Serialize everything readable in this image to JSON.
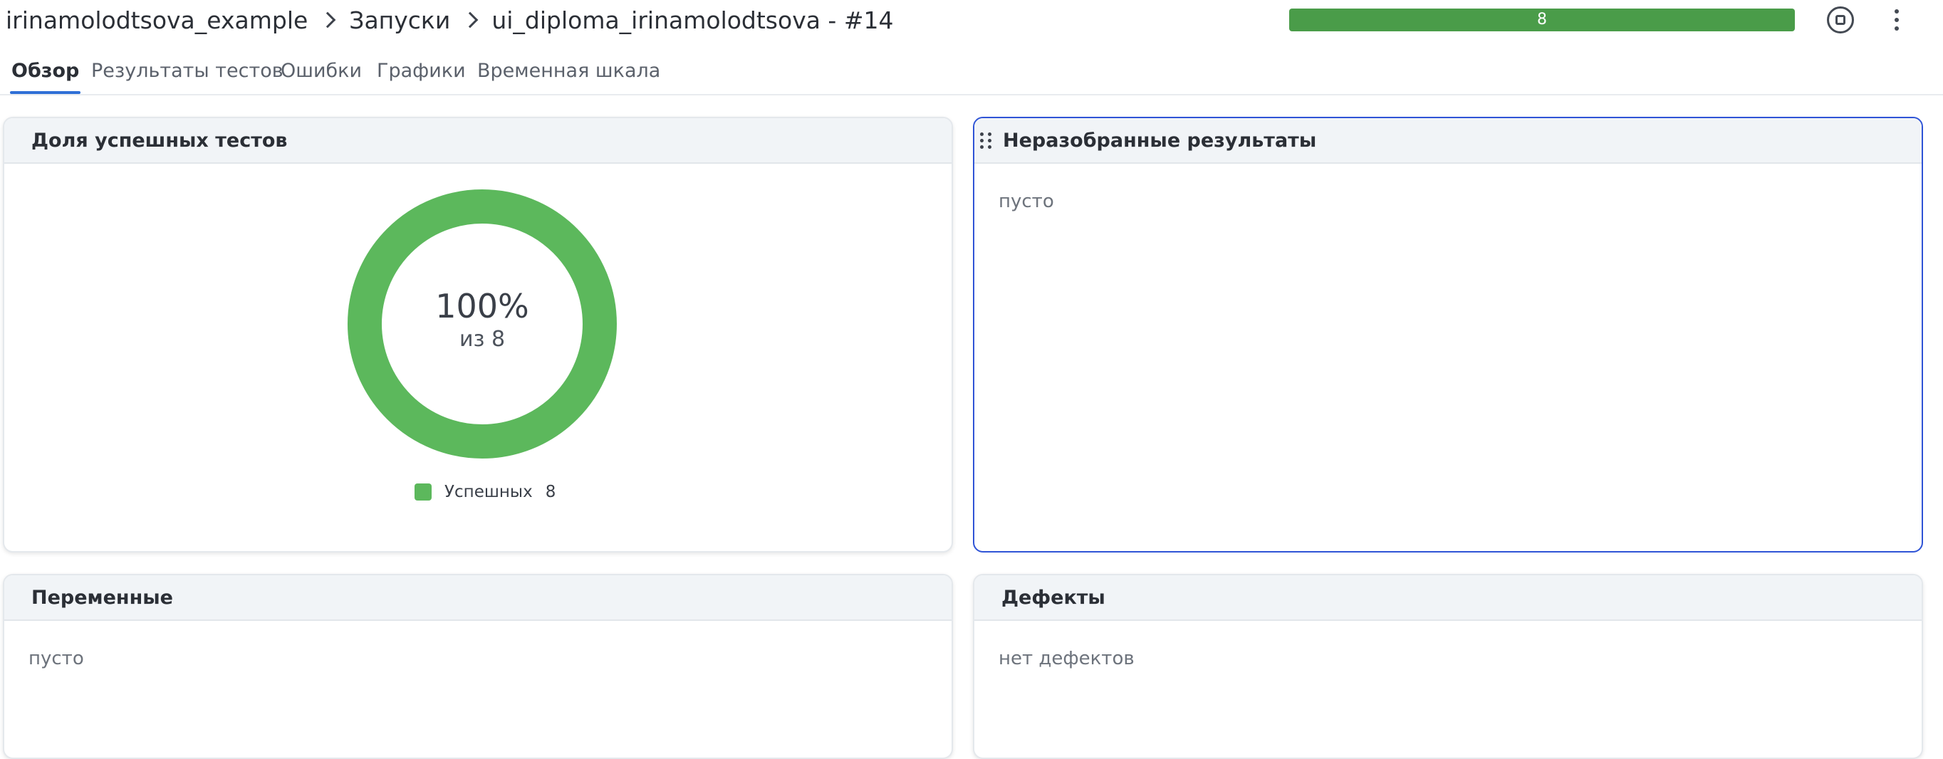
{
  "breadcrumb": {
    "project": "irinamolodtsova_example",
    "section": "Запуски",
    "launch": "ui_diploma_irinamolodtsova - #14"
  },
  "progress": {
    "label": "8",
    "fraction": 1.0,
    "color": "#4a9c49"
  },
  "tabs": [
    {
      "label": "Обзор",
      "active": true
    },
    {
      "label": "Результаты тестов",
      "active": false
    },
    {
      "label": "Ошибки",
      "active": false
    },
    {
      "label": "Графики",
      "active": false
    },
    {
      "label": "Временная шкала",
      "active": false
    }
  ],
  "widgets": {
    "pass_rate": {
      "title": "Доля успешных тестов",
      "percent": "100%",
      "subtitle": "из 8",
      "legend": [
        {
          "label": "Успешных",
          "count": "8",
          "color": "#5cb85c"
        }
      ]
    },
    "unresolved": {
      "title": "Неразобранные результаты",
      "empty": "пусто"
    },
    "variables": {
      "title": "Переменные",
      "empty": "пусто"
    },
    "defects": {
      "title": "Дефекты",
      "empty": "нет дефектов"
    }
  },
  "chart_data": {
    "type": "pie",
    "categories": [
      "Успешных"
    ],
    "values": [
      8
    ],
    "colors": [
      "#5cb85c"
    ]
  },
  "icons": {
    "stop": "stop-circle-icon",
    "more": "more-vertical-icon",
    "drag": "drag-handle-icon"
  }
}
